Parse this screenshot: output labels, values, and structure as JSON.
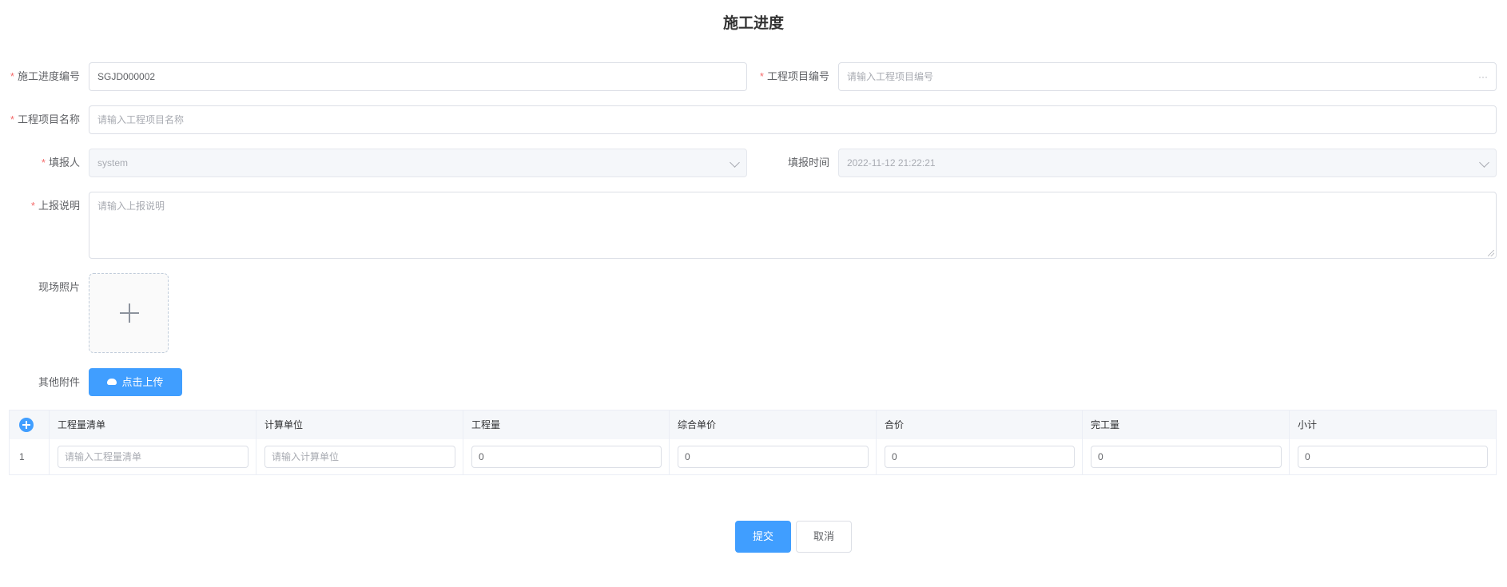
{
  "page_title": "施工进度",
  "form": {
    "progress_no": {
      "label": "施工进度编号",
      "value": "SGJD000002"
    },
    "project_no": {
      "label": "工程项目编号",
      "placeholder": "请输入工程项目编号",
      "suffix": "···"
    },
    "project_name": {
      "label": "工程项目名称",
      "placeholder": "请输入工程项目名称"
    },
    "reporter": {
      "label": "填报人",
      "value": "system"
    },
    "report_time": {
      "label": "填报时间",
      "value": "2022-11-12 21:22:21"
    },
    "description": {
      "label": "上报说明",
      "placeholder": "请输入上报说明"
    },
    "photos": {
      "label": "现场照片"
    },
    "attachments": {
      "label": "其他附件",
      "button": "点击上传"
    }
  },
  "table": {
    "columns": [
      "工程量清单",
      "计算单位",
      "工程量",
      "综合单价",
      "合价",
      "完工量",
      "小计"
    ],
    "rows": [
      {
        "index": "1",
        "bill_placeholder": "请输入工程量清单",
        "unit_placeholder": "请输入计算单位",
        "quantity": "0",
        "unit_price": "0",
        "total_price": "0",
        "completed": "0",
        "subtotal": "0"
      }
    ]
  },
  "actions": {
    "submit": "提交",
    "cancel": "取消"
  },
  "colors": {
    "primary": "#409eff",
    "required": "#f56c6c"
  },
  "icons": {
    "upload": "cloud-upload-icon",
    "add": "plus-circle-icon",
    "more": "ellipsis-icon",
    "dropdown": "chevron-down-icon"
  }
}
